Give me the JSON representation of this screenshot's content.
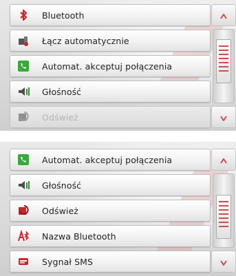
{
  "screen1": {
    "items": [
      {
        "label": "Bluetooth",
        "icon": "bluetooth-icon"
      },
      {
        "label": "Łącz automatycznie",
        "icon": "auto-connect-icon"
      },
      {
        "label": "Automat. akceptuj połączenia",
        "icon": "phone-accept-icon"
      },
      {
        "label": "Głośność",
        "icon": "volume-icon"
      },
      {
        "label": "Odśwież",
        "icon": "refresh-icon",
        "state": "disabled"
      }
    ]
  },
  "screen2": {
    "items": [
      {
        "label": "Automat. akceptuj połączenia",
        "icon": "phone-accept-icon"
      },
      {
        "label": "Głośność",
        "icon": "volume-icon"
      },
      {
        "label": "Odśwież",
        "icon": "refresh-icon"
      },
      {
        "label": "Nazwa Bluetooth",
        "icon": "bluetooth-name-icon"
      },
      {
        "label": "Sygnał SMS",
        "icon": "sms-signal-icon"
      }
    ]
  },
  "colors": {
    "accent_red": "#d34b4b",
    "phone_green": "#3aa83a",
    "bluetooth_red": "#c8252b"
  }
}
